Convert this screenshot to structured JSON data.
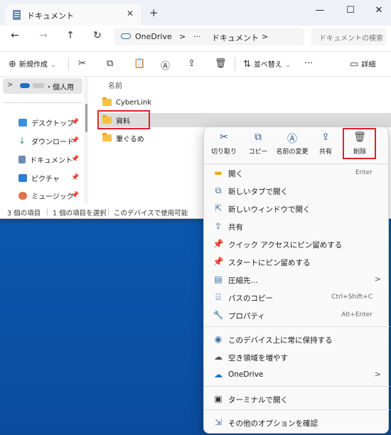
{
  "window": {
    "tab_title": "ドキュメント",
    "tab_close": "✕",
    "new_tab": "+",
    "minimize": "—",
    "maximize": "☐",
    "close": "✕"
  },
  "nav": {
    "back": "←",
    "forward": "→",
    "up": "↑",
    "refresh": "↻",
    "address": {
      "root": "OneDrive",
      "sep1": ">",
      "ellipsis": "···",
      "current": "ドキュメント",
      "sep2": ">"
    },
    "search_placeholder": "ドキュメントの検索"
  },
  "toolbar": {
    "new_label": "新規作成",
    "sort_label": "並べ替え",
    "more": "···",
    "details_label": "詳細"
  },
  "sidebar": {
    "root_label": "・個人用",
    "root_chevron": ">",
    "items": [
      {
        "label": "デスクトップ",
        "pin": "📌",
        "color": "#3b8fd9"
      },
      {
        "label": "ダウンロード",
        "pin": "📌",
        "color": "#2f9e5a"
      },
      {
        "label": "ドキュメント",
        "pin": "📌",
        "color": "#6c8bb0"
      },
      {
        "label": "ピクチャ",
        "pin": "📌",
        "color": "#2d7fd1"
      },
      {
        "label": "ミュージック",
        "pin": "📌",
        "color": "#e0714b"
      }
    ]
  },
  "content": {
    "column_header": "名前",
    "files": [
      {
        "name": "CyberLink"
      },
      {
        "name": "資料"
      },
      {
        "name": "筆ぐるめ"
      }
    ]
  },
  "status": {
    "count": "3 個の項目",
    "selected": "1 個の項目を選択",
    "availability": "このデバイスで使用可能"
  },
  "context_menu": {
    "quick_actions": [
      {
        "label": "切り取り",
        "icon": "✂"
      },
      {
        "label": "コピー",
        "icon": "⧉"
      },
      {
        "label": "名前の変更",
        "icon": "Ⓐ"
      },
      {
        "label": "共有",
        "icon": "⇪"
      },
      {
        "label": "削除",
        "icon": "🗑"
      }
    ],
    "items": [
      {
        "label": "開く",
        "shortcut": "Enter",
        "icon": "▬"
      },
      {
        "label": "新しいタブで開く",
        "icon": "⧉"
      },
      {
        "label": "新しいウィンドウで開く",
        "icon": "⇱"
      },
      {
        "label": "共有",
        "icon": "⇪"
      },
      {
        "label": "クイック アクセスにピン留めする",
        "icon": "📌"
      },
      {
        "label": "スタートにピン留めする",
        "icon": "📌"
      },
      {
        "label": "圧縮先...",
        "icon": "▤",
        "chevron": ">"
      },
      {
        "label": "パスのコピー",
        "shortcut": "Ctrl+Shift+C",
        "icon": "⌸"
      },
      {
        "label": "プロパティ",
        "shortcut": "Alt+Enter",
        "icon": "🔧"
      },
      {
        "label": "このデバイス上に常に保持する",
        "icon": "◉"
      },
      {
        "label": "空き領域を増やす",
        "icon": "☁"
      },
      {
        "label": "OneDrive",
        "icon": "☁",
        "chevron": ">"
      },
      {
        "label": "ターミナルで開く",
        "icon": "▣"
      },
      {
        "label": "その他のオプションを確認",
        "icon": "⇲"
      }
    ]
  }
}
